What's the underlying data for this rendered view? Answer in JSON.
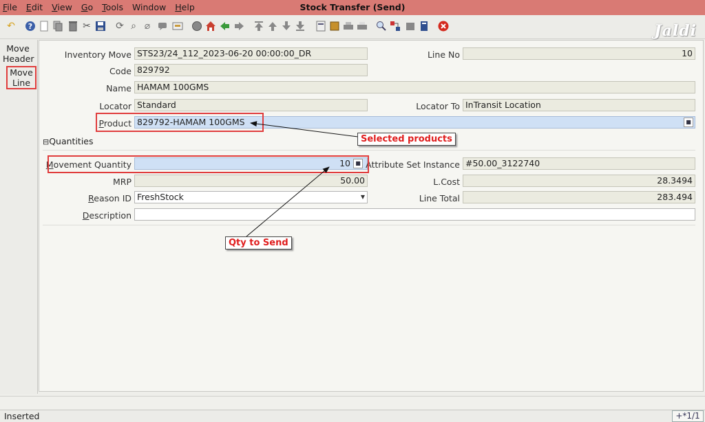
{
  "menu": [
    "File",
    "Edit",
    "View",
    "Go",
    "Tools",
    "Window",
    "Help"
  ],
  "window_title": "Stock Transfer (Send)",
  "watermark": "Jaldi",
  "toolbar_icons": [
    "undo-icon",
    "help-icon",
    "new-icon",
    "copy-icon",
    "delete-icon",
    "delete-selection-icon",
    "save-icon",
    "refresh-icon",
    "find-icon",
    "attachment-icon",
    "chat-icon",
    "history-icon",
    "request-icon",
    "home-icon",
    "back-icon",
    "forward-icon",
    "first-record-icon",
    "previous-record-icon",
    "next-record-icon",
    "last-record-icon",
    "report-icon",
    "archive-icon",
    "print-icon",
    "print-preview-icon",
    "zoom-across-icon",
    "active-workflows-icon",
    "product-info-icon",
    "end-icon",
    "close-icon"
  ],
  "nav": {
    "move_header": "Move\nHeader",
    "move_line": "Move\nLine"
  },
  "form": {
    "inventory_move": {
      "label": "Inventory Move",
      "value": "STS23/24_112_2023-06-20 00:00:00_DR"
    },
    "line_no": {
      "label": "Line No",
      "value": "10"
    },
    "code": {
      "label": "Code",
      "value": "829792"
    },
    "name": {
      "label": "Name",
      "value": "HAMAM 100GMS"
    },
    "locator": {
      "label": "Locator",
      "value": "Standard"
    },
    "locator_to": {
      "label": "Locator To",
      "value": "InTransit Location"
    },
    "product": {
      "label": "Product",
      "value": "829792-HAMAM 100GMS"
    },
    "section_title": "Quantities",
    "movement_quantity": {
      "label": "Movement Quantity",
      "value": "10"
    },
    "attribute_set_instance": {
      "label": "Attribute Set Instance",
      "value": "#50.00_3122740"
    },
    "mrp": {
      "label": "MRP",
      "value": "50.00"
    },
    "l_cost": {
      "label": "L.Cost",
      "value": "28.3494"
    },
    "reason_id": {
      "label": "Reason ID",
      "value": "FreshStock"
    },
    "line_total": {
      "label": "Line Total",
      "value": "283.494"
    },
    "description": {
      "label": "Description",
      "value": ""
    }
  },
  "annotations": {
    "selected_products": "Selected products",
    "qty_to_send": "Qty to Send"
  },
  "status": {
    "text": "Inserted",
    "record": "+*1/1"
  }
}
